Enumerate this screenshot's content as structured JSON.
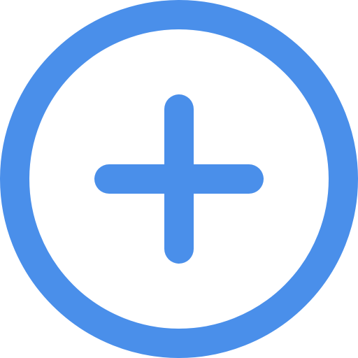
{
  "icon": {
    "name": "add-circle-icon",
    "color": "#4a8fea",
    "background": "#ffffff"
  }
}
